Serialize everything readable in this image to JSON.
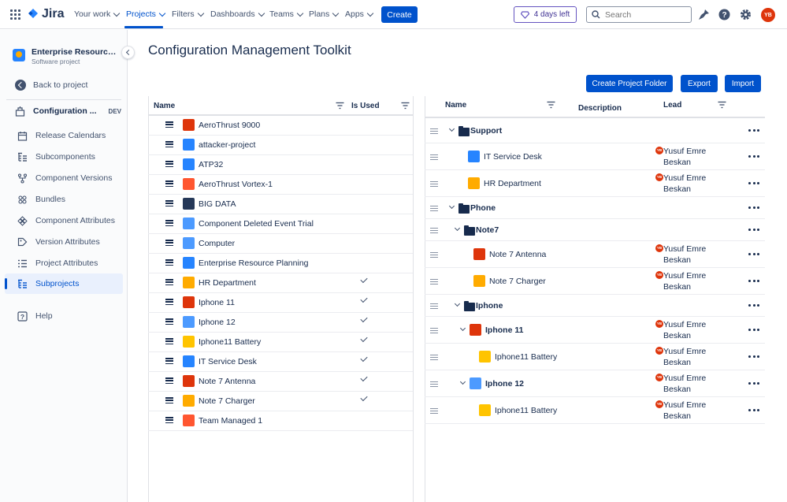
{
  "topnav": {
    "logo": "Jira",
    "items": [
      {
        "label": "Your work"
      },
      {
        "label": "Projects"
      },
      {
        "label": "Filters"
      },
      {
        "label": "Dashboards"
      },
      {
        "label": "Teams"
      },
      {
        "label": "Plans"
      },
      {
        "label": "Apps"
      }
    ],
    "create_label": "Create",
    "trial_label": "4 days left",
    "search_placeholder": "Search",
    "avatar_initials": "YB"
  },
  "sidebar": {
    "project_name": "Enterprise Resource Planning",
    "project_type": "Software project",
    "back_label": "Back to project",
    "section_label": "Configuration Management Toolkit",
    "section_badge": "DEV",
    "items": [
      {
        "label": "Release Calendars",
        "icon": "calendar-icon"
      },
      {
        "label": "Subcomponents",
        "icon": "hierarchy-icon"
      },
      {
        "label": "Component Versions",
        "icon": "branch-icon"
      },
      {
        "label": "Bundles",
        "icon": "bundle-icon"
      },
      {
        "label": "Component Attributes",
        "icon": "component-icon"
      },
      {
        "label": "Version Attributes",
        "icon": "version-icon"
      },
      {
        "label": "Project Attributes",
        "icon": "list-icon"
      },
      {
        "label": "Subprojects",
        "icon": "hierarchy-icon"
      }
    ],
    "help_label": "Help"
  },
  "main": {
    "title": "Configuration Management Toolkit",
    "buttons": {
      "create_folder": "Create Project Folder",
      "export": "Export",
      "import": "Import"
    }
  },
  "left_table": {
    "headers": {
      "name": "Name",
      "is_used": "Is Used"
    },
    "rows": [
      {
        "name": "AeroThrust 9000",
        "used": false,
        "color": "#DE350B"
      },
      {
        "name": "attacker-project",
        "used": false,
        "color": "#2684FF"
      },
      {
        "name": "ATP32",
        "used": false,
        "color": "#2684FF"
      },
      {
        "name": "AeroThrust Vortex-1",
        "used": false,
        "color": "#FF5630"
      },
      {
        "name": "BIG DATA",
        "used": false,
        "color": "#253858"
      },
      {
        "name": "Component Deleted Event Trial",
        "used": false,
        "color": "#4C9AFF"
      },
      {
        "name": "Computer",
        "used": false,
        "color": "#4C9AFF"
      },
      {
        "name": "Enterprise Resource Planning",
        "used": false,
        "color": "#2684FF"
      },
      {
        "name": "HR Department",
        "used": true,
        "color": "#FFAB00"
      },
      {
        "name": "Iphone 11",
        "used": true,
        "color": "#DE350B"
      },
      {
        "name": "Iphone 12",
        "used": true,
        "color": "#4C9AFF"
      },
      {
        "name": "Iphone11 Battery",
        "used": true,
        "color": "#FFC400"
      },
      {
        "name": "IT Service Desk",
        "used": true,
        "color": "#2684FF"
      },
      {
        "name": "Note 7 Antenna",
        "used": true,
        "color": "#DE350B"
      },
      {
        "name": "Note 7 Charger",
        "used": true,
        "color": "#FFAB00"
      },
      {
        "name": "Team Managed 1",
        "used": false,
        "color": "#FF5630"
      }
    ]
  },
  "right_table": {
    "headers": {
      "name": "Name",
      "description": "Description",
      "lead": "Lead"
    },
    "lead_name": "Yusuf Emre Beskan",
    "lead_initials": "YB",
    "rows": [
      {
        "name": "Support",
        "kind": "folder",
        "level": 0,
        "expanded": true
      },
      {
        "name": "IT Service Desk",
        "kind": "project",
        "level": 1,
        "color": "#2684FF",
        "lead": true
      },
      {
        "name": "HR Department",
        "kind": "project",
        "level": 1,
        "color": "#FFAB00",
        "lead": true
      },
      {
        "name": "Phone",
        "kind": "folder",
        "level": 0,
        "expanded": true
      },
      {
        "name": "Note7",
        "kind": "folder",
        "level": 1,
        "expanded": true
      },
      {
        "name": "Note 7 Antenna",
        "kind": "project",
        "level": 2,
        "color": "#DE350B",
        "lead": true
      },
      {
        "name": "Note 7 Charger",
        "kind": "project",
        "level": 2,
        "color": "#FFAB00",
        "lead": true
      },
      {
        "name": "Iphone",
        "kind": "folder",
        "level": 1,
        "expanded": true
      },
      {
        "name": "Iphone 11",
        "kind": "project-parent",
        "level": 2,
        "color": "#DE350B",
        "lead": true
      },
      {
        "name": "Iphone11 Battery",
        "kind": "project",
        "level": 3,
        "color": "#FFC400",
        "lead": true
      },
      {
        "name": "Iphone 12",
        "kind": "project-parent",
        "level": 2,
        "color": "#4C9AFF",
        "lead": true
      },
      {
        "name": "Iphone11 Battery",
        "kind": "project",
        "level": 3,
        "color": "#FFC400",
        "lead": true
      }
    ]
  }
}
